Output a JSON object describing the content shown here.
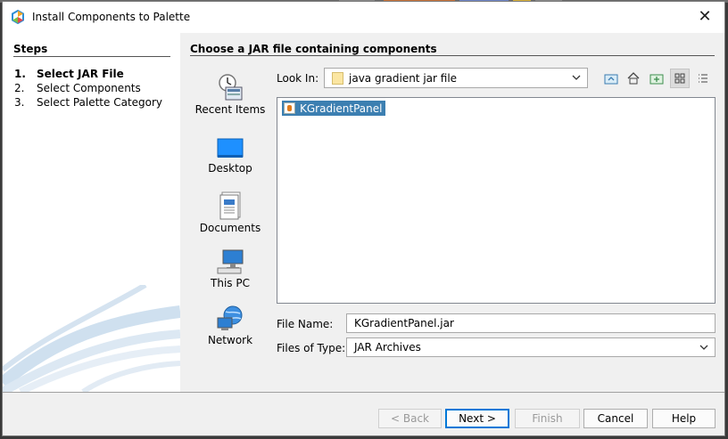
{
  "window": {
    "title": "Install Components to Palette",
    "close_glyph": "✕"
  },
  "steps": {
    "heading": "Steps",
    "items": [
      {
        "number": "1.",
        "label": "Select JAR File"
      },
      {
        "number": "2.",
        "label": "Select Components"
      },
      {
        "number": "3.",
        "label": "Select Palette Category"
      }
    ]
  },
  "main": {
    "heading": "Choose a JAR file containing components",
    "places": [
      "Recent Items",
      "Desktop",
      "Documents",
      "This PC",
      "Network"
    ],
    "look_in": {
      "label": "Look In:",
      "value": "java gradient jar file"
    },
    "toolbar_icons": [
      "up-folder-icon",
      "home-icon",
      "new-folder-icon",
      "list-view-icon",
      "details-view-icon"
    ],
    "files": [
      {
        "name": "KGradientPanel"
      }
    ],
    "file_name": {
      "label": "File Name:",
      "value": "KGradientPanel.jar"
    },
    "file_type": {
      "label": "Files of Type:",
      "value": "JAR Archives"
    }
  },
  "buttons": {
    "back": "< Back",
    "next": "Next >",
    "finish": "Finish",
    "cancel": "Cancel",
    "help": "Help"
  },
  "colors": {
    "selection": "#3c7fb1",
    "accent": "#0078d7",
    "window_bg": "#f0f0f0"
  }
}
